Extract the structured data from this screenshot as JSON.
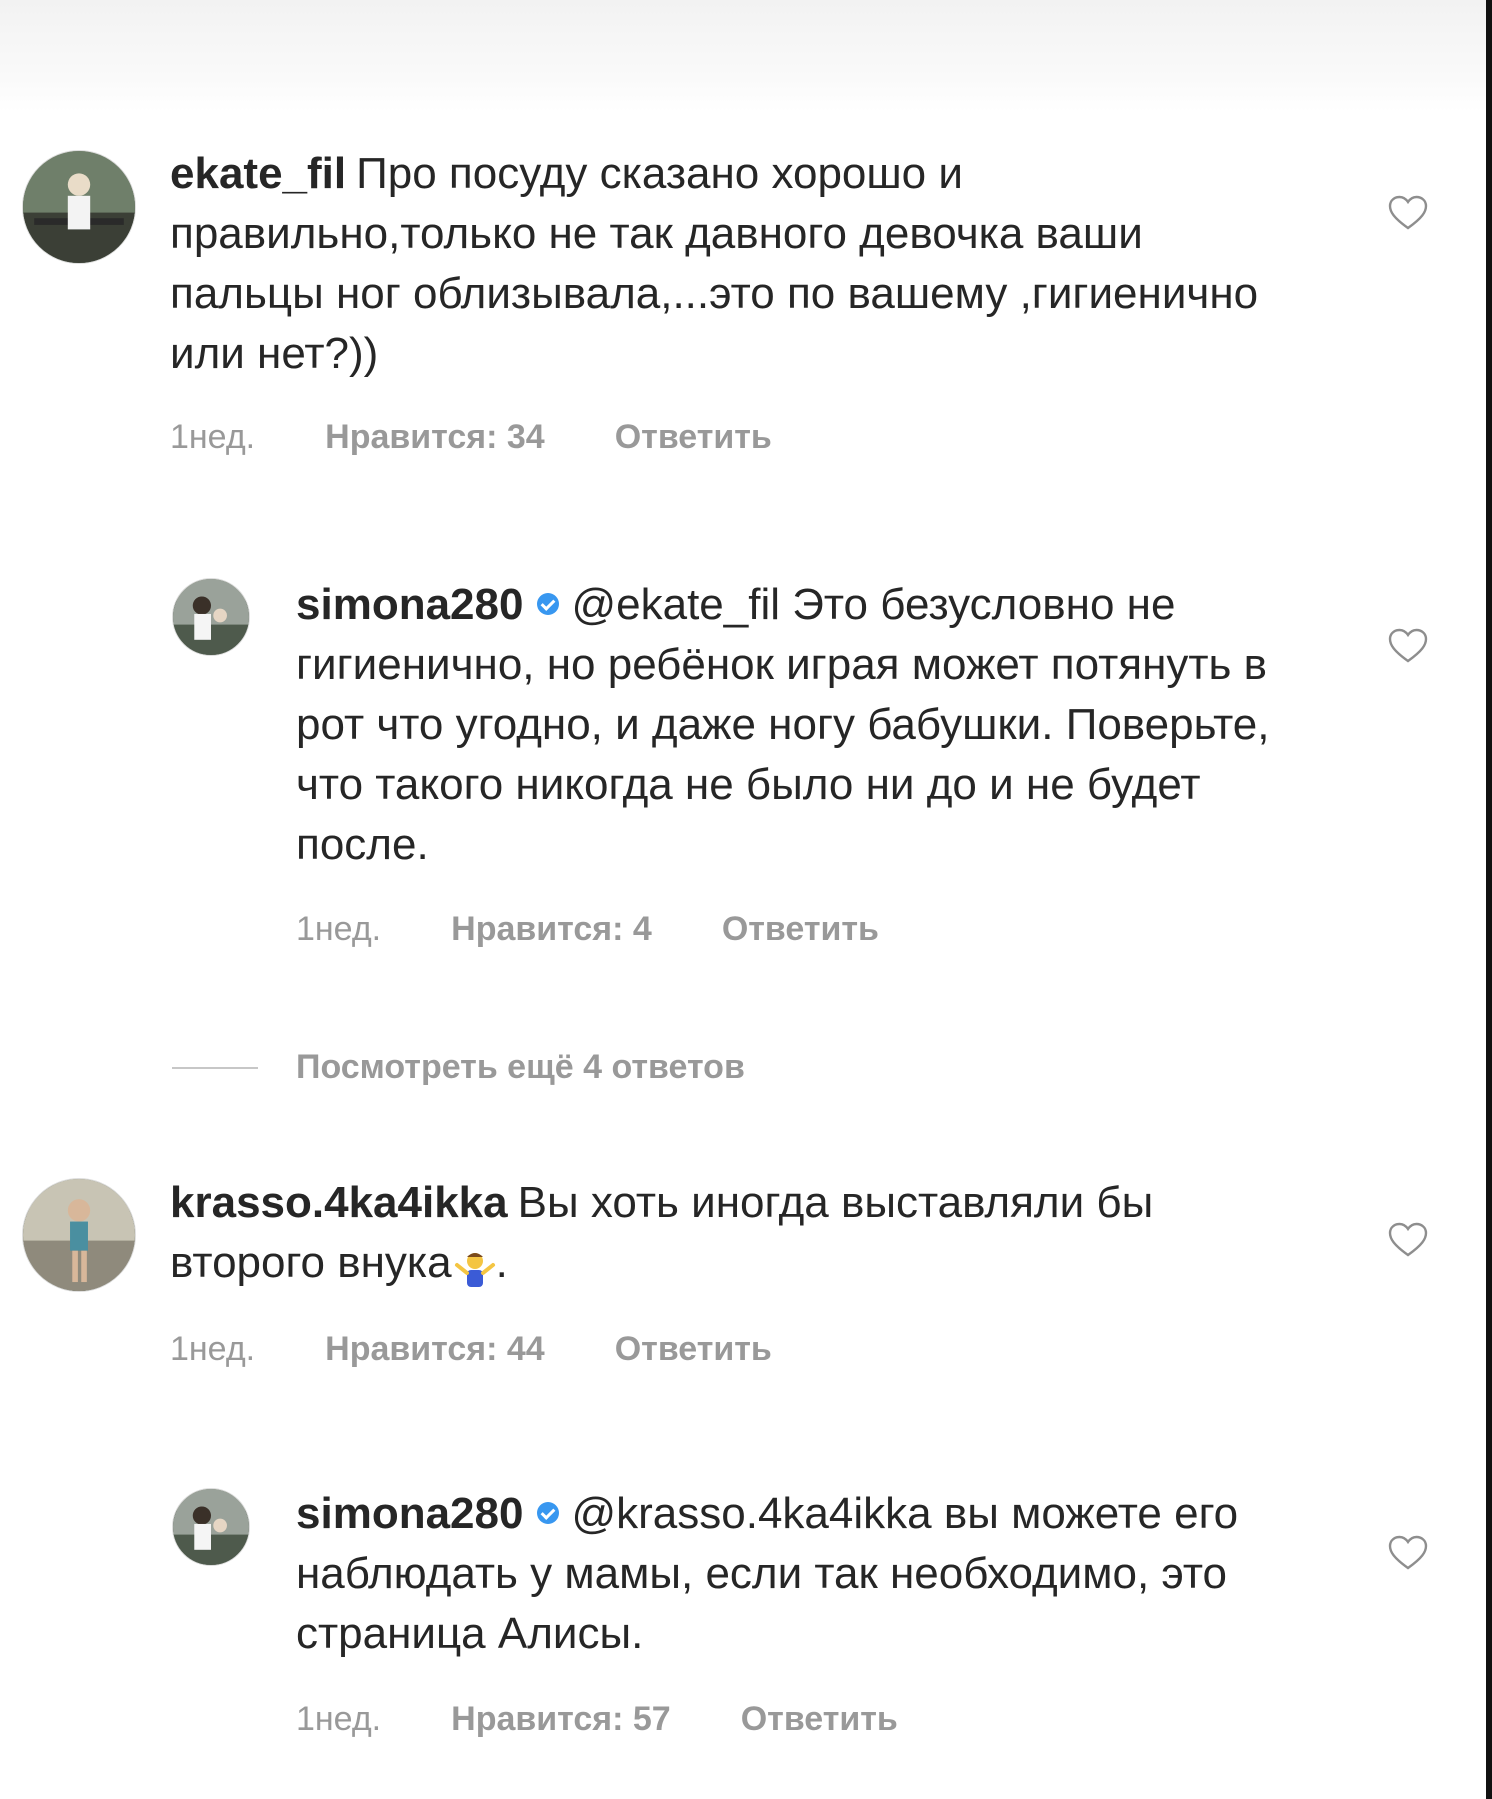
{
  "comments": [
    {
      "username": "ekate_fil",
      "text": "Про посуду сказано хорошо и правильно,только не так давного девочка ваши пальцы ног облизывала,...это по вашему ,гигиенично или нет?))",
      "time": "1нед.",
      "likes": "Нравится: 34",
      "reply": "Ответить"
    },
    {
      "username": "simona280",
      "mention": "@ekate_fil",
      "text": "Это безусловно не гигиенично, но ребёнок играя может потянуть в рот что угодно, и даже ногу бабушки. Поверьте, что такого никогда не было ни до и не будет после.",
      "time": "1нед.",
      "likes": "Нравится: 4",
      "reply": "Ответить"
    },
    {
      "username": "krasso.4ka4ikka",
      "text": "Вы хоть иногда выставляли бы второго внука",
      "text_end": ".",
      "time": "1нед.",
      "likes": "Нравится: 44",
      "reply": "Ответить"
    },
    {
      "username": "simona280",
      "mention": "@krasso.4ka4ikka",
      "text": "вы можете его наблюдать у мамы, если так необходимо, это страница Алисы.",
      "time": "1нед.",
      "likes": "Нравится: 57",
      "reply": "Ответить"
    }
  ],
  "view_more": "Посмотреть ещё 4 ответов",
  "icons": {
    "like": "heart-outline-icon",
    "verified": "verified-badge-icon",
    "emoji": "person-shrugging-emoji"
  },
  "colors": {
    "text": "#262626",
    "meta": "#999999",
    "verified": "#3897f0"
  }
}
